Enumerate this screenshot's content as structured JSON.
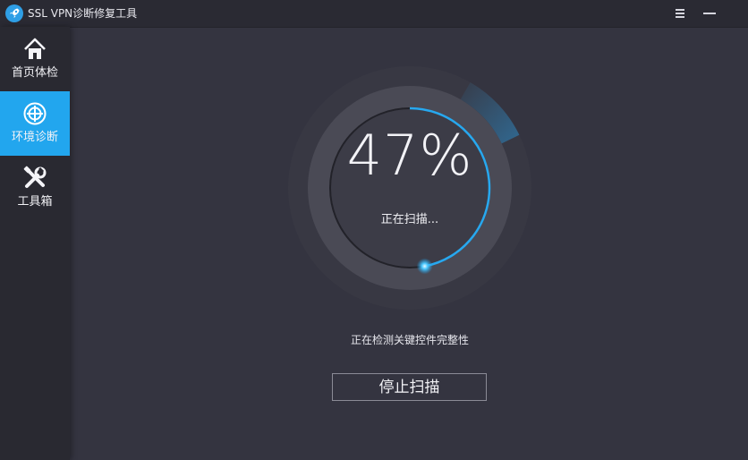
{
  "app": {
    "title": "SSL VPN诊断修复工具",
    "accent_color": "#22a6ee",
    "logo_icon": "rocket-icon"
  },
  "window_controls": {
    "menu_icon": "menu-icon",
    "minimize_icon": "minimize-icon"
  },
  "sidebar": {
    "items": [
      {
        "label": "首页体检",
        "icon": "home-icon",
        "active": false
      },
      {
        "label": "环境诊断",
        "icon": "crosshair-icon",
        "active": true
      },
      {
        "label": "工具箱",
        "icon": "tools-icon",
        "active": false
      }
    ]
  },
  "scan": {
    "percent": 47,
    "percent_text": "47%",
    "status": "正在扫描...",
    "detail": "正在检测关键控件完整性",
    "stop_label": "停止扫描"
  }
}
